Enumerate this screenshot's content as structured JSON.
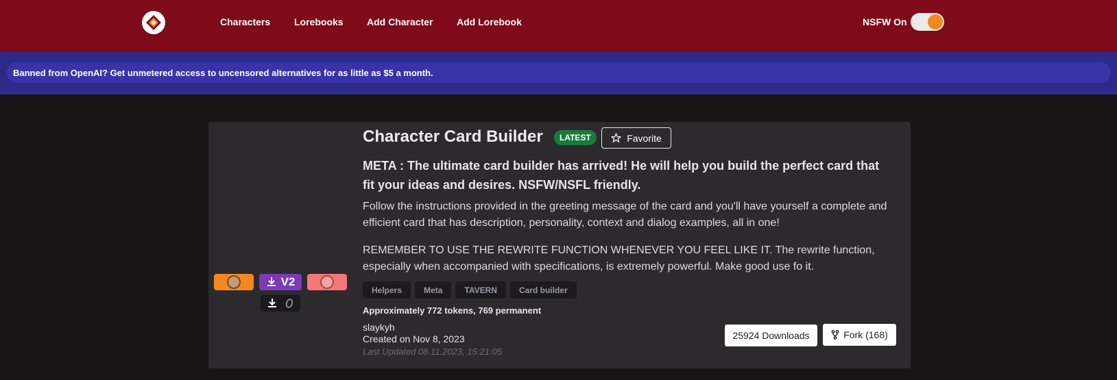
{
  "nav": {
    "logo": "site-logo",
    "items": [
      "Characters",
      "Lorebooks",
      "Add Character",
      "Add Lorebook"
    ],
    "nsfw_label": "NSFW On",
    "nsfw_enabled": true
  },
  "banner": {
    "text": "Banned from OpenAI? Get unmetered access to uncensored alternatives for as little as $5 a month."
  },
  "card": {
    "title": "Character Card Builder",
    "latest_badge": "LATEST",
    "favorite_label": "Favorite",
    "tagline": "META : The ultimate card builder has arrived! He will help you build the perfect card that fit your ideas and desires. NSFW/NSFL friendly.",
    "description_1": "Follow the instructions provided in the greeting message of the card and you'll have yourself a complete and efficient card that has description, personality, context and dialog examples, all in one!",
    "description_2": "REMEMBER TO USE THE REWRITE FUNCTION WHENEVER YOU FEEL LIKE IT. The rewrite function, especially when accompanied with specifications, is extremely powerful. Make good use fo it.",
    "download_v2_label": "V2",
    "tags": [
      "Helpers",
      "Meta",
      "TAVERN",
      "Card builder"
    ],
    "tokens": "Approximately 772 tokens, 769 permanent",
    "author": "slaykyh",
    "created": "Created on Nov 8, 2023",
    "updated": "Last Updated 08.11.2023, 15:21:05",
    "downloads": "25924 Downloads",
    "fork": "Fork (168)"
  },
  "colors": {
    "header": "#7f0a19",
    "banner": "#3a33a8",
    "accent_orange": "#f6861f",
    "latest_green": "#197a3e",
    "v2_purple": "#7d3ab8",
    "pink": "#f37777"
  }
}
